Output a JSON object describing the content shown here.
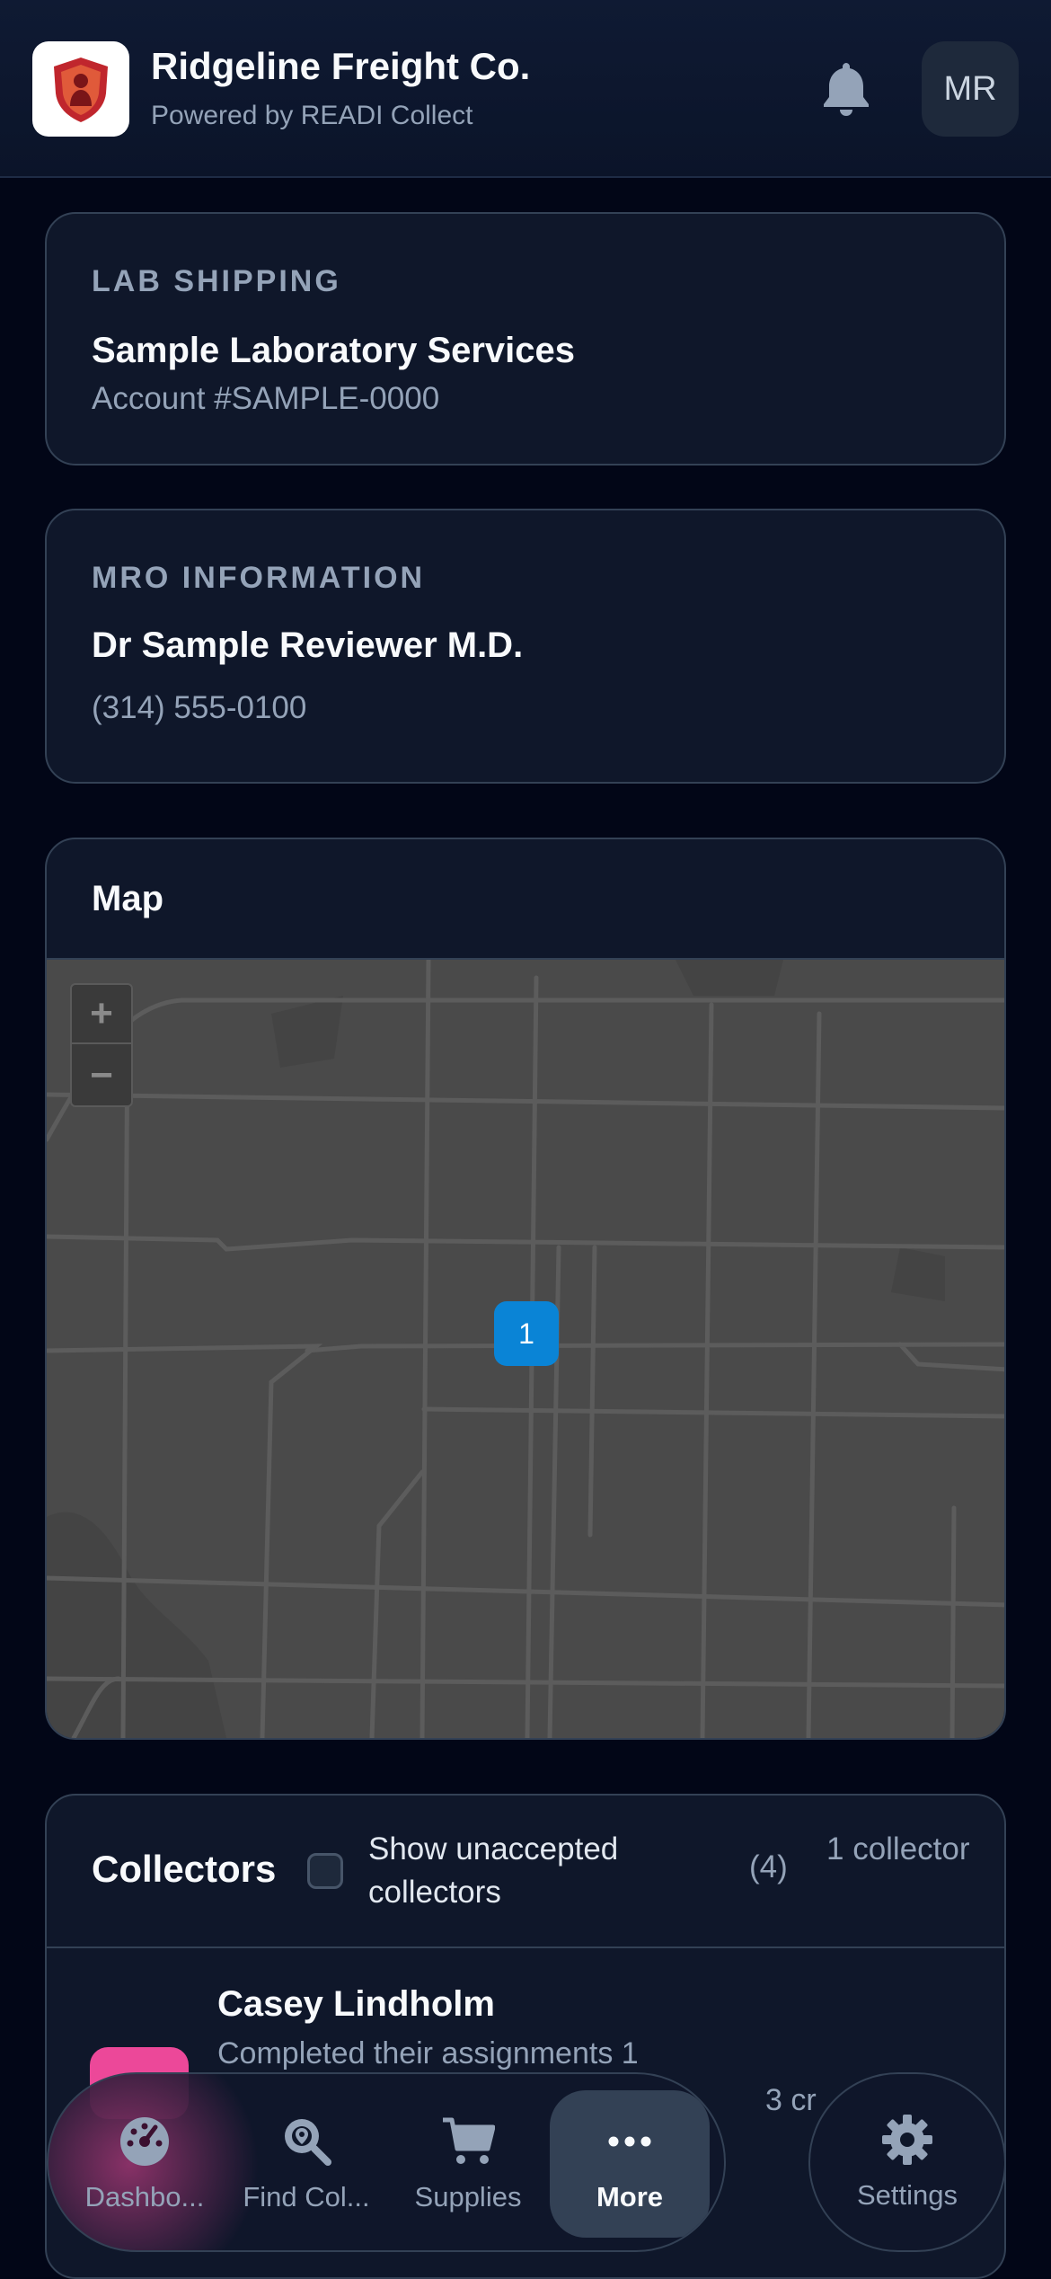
{
  "header": {
    "title": "Ridgeline Freight Co.",
    "subtitle": "Powered by READI Collect",
    "avatar_initials": "MR"
  },
  "lab_shipping": {
    "label": "LAB SHIPPING",
    "name": "Sample Laboratory Services",
    "account": "Account #SAMPLE-0000"
  },
  "mro": {
    "label": "MRO INFORMATION",
    "name": "Dr Sample Reviewer M.D.",
    "phone": "(314) 555-0100"
  },
  "map": {
    "title": "Map",
    "zoom_in": "+",
    "zoom_out": "−",
    "cluster_count": "1"
  },
  "collectors": {
    "title": "Collectors",
    "show_unaccepted_label": "Show unaccepted collectors",
    "unaccepted_count": "(4)",
    "collector_count": "1 collector",
    "rows": [
      {
        "name": "Casey Lindholm",
        "description": "Completed their assignments 1",
        "meta": "3 cr"
      }
    ]
  },
  "tabs": [
    {
      "label": "Dashbo...",
      "icon": "dashboard-gauge-icon"
    },
    {
      "label": "Find Col...",
      "icon": "search-location-icon"
    },
    {
      "label": "Supplies",
      "icon": "cart-icon"
    },
    {
      "label": "More",
      "icon": "more-dots-icon",
      "active": true
    }
  ],
  "settings": {
    "label": "Settings",
    "icon": "gear-icon"
  },
  "colors": {
    "background": "#020617",
    "card": "#0f172a",
    "border": "#334155",
    "accent_pink": "#ec4899",
    "map_marker": "#0a84d6"
  }
}
